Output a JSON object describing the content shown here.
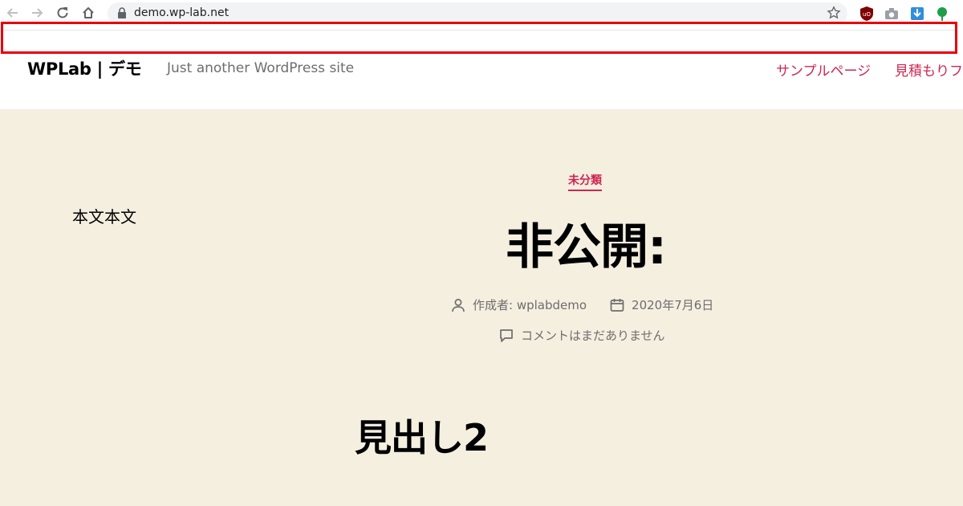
{
  "browser": {
    "url": "demo.wp-lab.net",
    "icons": [
      "back-icon",
      "forward-icon",
      "reload-icon",
      "home-icon",
      "lock-icon",
      "star-icon",
      "ublock-icon",
      "camera-icon",
      "download-icon",
      "extension-icon"
    ]
  },
  "site": {
    "title": "WPLab | デモ",
    "description": "Just another WordPress site",
    "menu": [
      "サンプルページ",
      "見積もりフ"
    ]
  },
  "sidebar_text": "本文本文",
  "post": {
    "category": "未分類",
    "title": "非公開:",
    "author": "作成者: wplabdemo",
    "date": "2020年7月6日",
    "comments": "コメントはまだありません",
    "heading2": "見出し2"
  },
  "colors": {
    "accent": "#cd2653",
    "content_bg": "#f5efe0",
    "annotation": "#e8000b",
    "meta_text": "#6d6d6d"
  }
}
